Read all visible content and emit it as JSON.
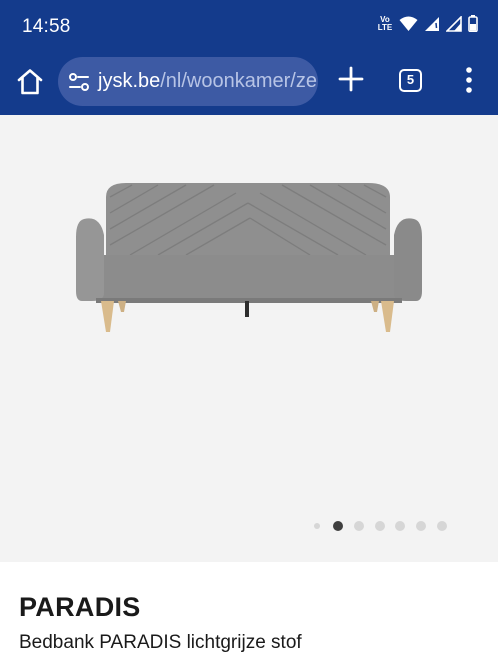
{
  "status_bar": {
    "time": "14:58",
    "volte_top": "Vo",
    "volte_bottom": "LTE",
    "icons": [
      "volte-icon",
      "wifi-icon",
      "signal-icon",
      "signal-icon",
      "battery-icon"
    ]
  },
  "browser": {
    "url_domain": "jysk.be",
    "url_path": "/nl/woonkamer/ze",
    "tab_count": "5",
    "icons": [
      "home-icon",
      "site-settings-icon",
      "plus-icon",
      "tabs-icon",
      "more-icon"
    ]
  },
  "gallery": {
    "image_count": 6,
    "active_index": 0
  },
  "product": {
    "name": "PARADIS",
    "description": "Bedbank PARADIS lichtgrijze stof"
  },
  "colors": {
    "browser_chrome": "#143b8c",
    "url_box": "#3d5aa4",
    "gallery_bg": "#f3f3f3",
    "sofa_fabric": "#8c8c8c"
  }
}
